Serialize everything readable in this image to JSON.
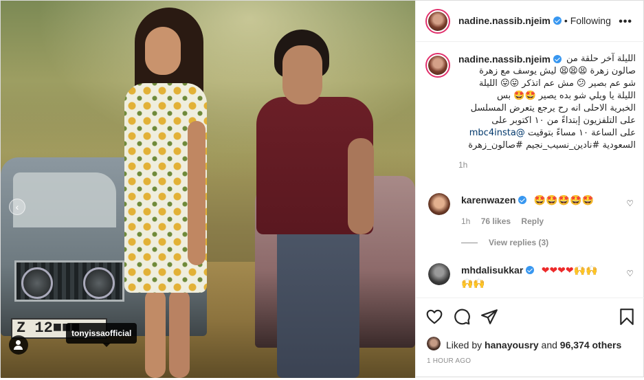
{
  "post": {
    "image": {
      "plate_text": "Z 12■■■",
      "tag_username": "tonyissaofficial"
    },
    "header": {
      "username": "nadine.nassib.njeim",
      "separator": "•",
      "follow_status": "Following",
      "more_glyph": "•••"
    },
    "caption": {
      "username": "nadine.nassib.njeim",
      "lines": [
        "الليلة آخر حلقة من",
        "صالون زهرة 😫😫😫 ليش يوسف مع زهرة",
        "شو عم بصير 😕 مش عم اتذكر 😛😛 الليلة",
        "الليلة يا ويلي شو بده يصير 🤩🤩 بس",
        "الخبرية الاحلى انه رح يرجع يتعرض المسلسل",
        "على التلفزيون إبتداءً من ١٠ اكتوبر على",
        "على الساعة ١٠ مساءً بتوقيت",
        "السعودية #نادين_نسيب_نجيم #صالون_زهرة"
      ],
      "mention": "@mbc4insta",
      "time": "1h"
    },
    "comments": [
      {
        "username": "karenwazen",
        "text": "🤩🤩🤩🤩🤩",
        "time": "1h",
        "likes": "76 likes",
        "reply_label": "Reply",
        "view_replies": "View replies (3)"
      },
      {
        "username": "mhdalisukkar",
        "text": "❤❤❤❤🙌🙌",
        "text2": "🙌🙌"
      }
    ],
    "likes": {
      "liked_by_prefix": "Liked by",
      "liked_by_user": "hanayousry",
      "and_text": "and",
      "others": "96,374 others"
    },
    "time_ago": "1 HOUR AGO"
  },
  "icons": [
    "heart-icon",
    "comment-icon",
    "share-icon",
    "bookmark-icon",
    "more-icon",
    "tag-person-icon",
    "verified-icon",
    "carousel-prev-icon"
  ],
  "colors": {
    "verified": "#3897f0",
    "story_ring": "#e1306c",
    "text": "#262626",
    "muted": "#8e8e8e",
    "mention": "#00376b"
  }
}
